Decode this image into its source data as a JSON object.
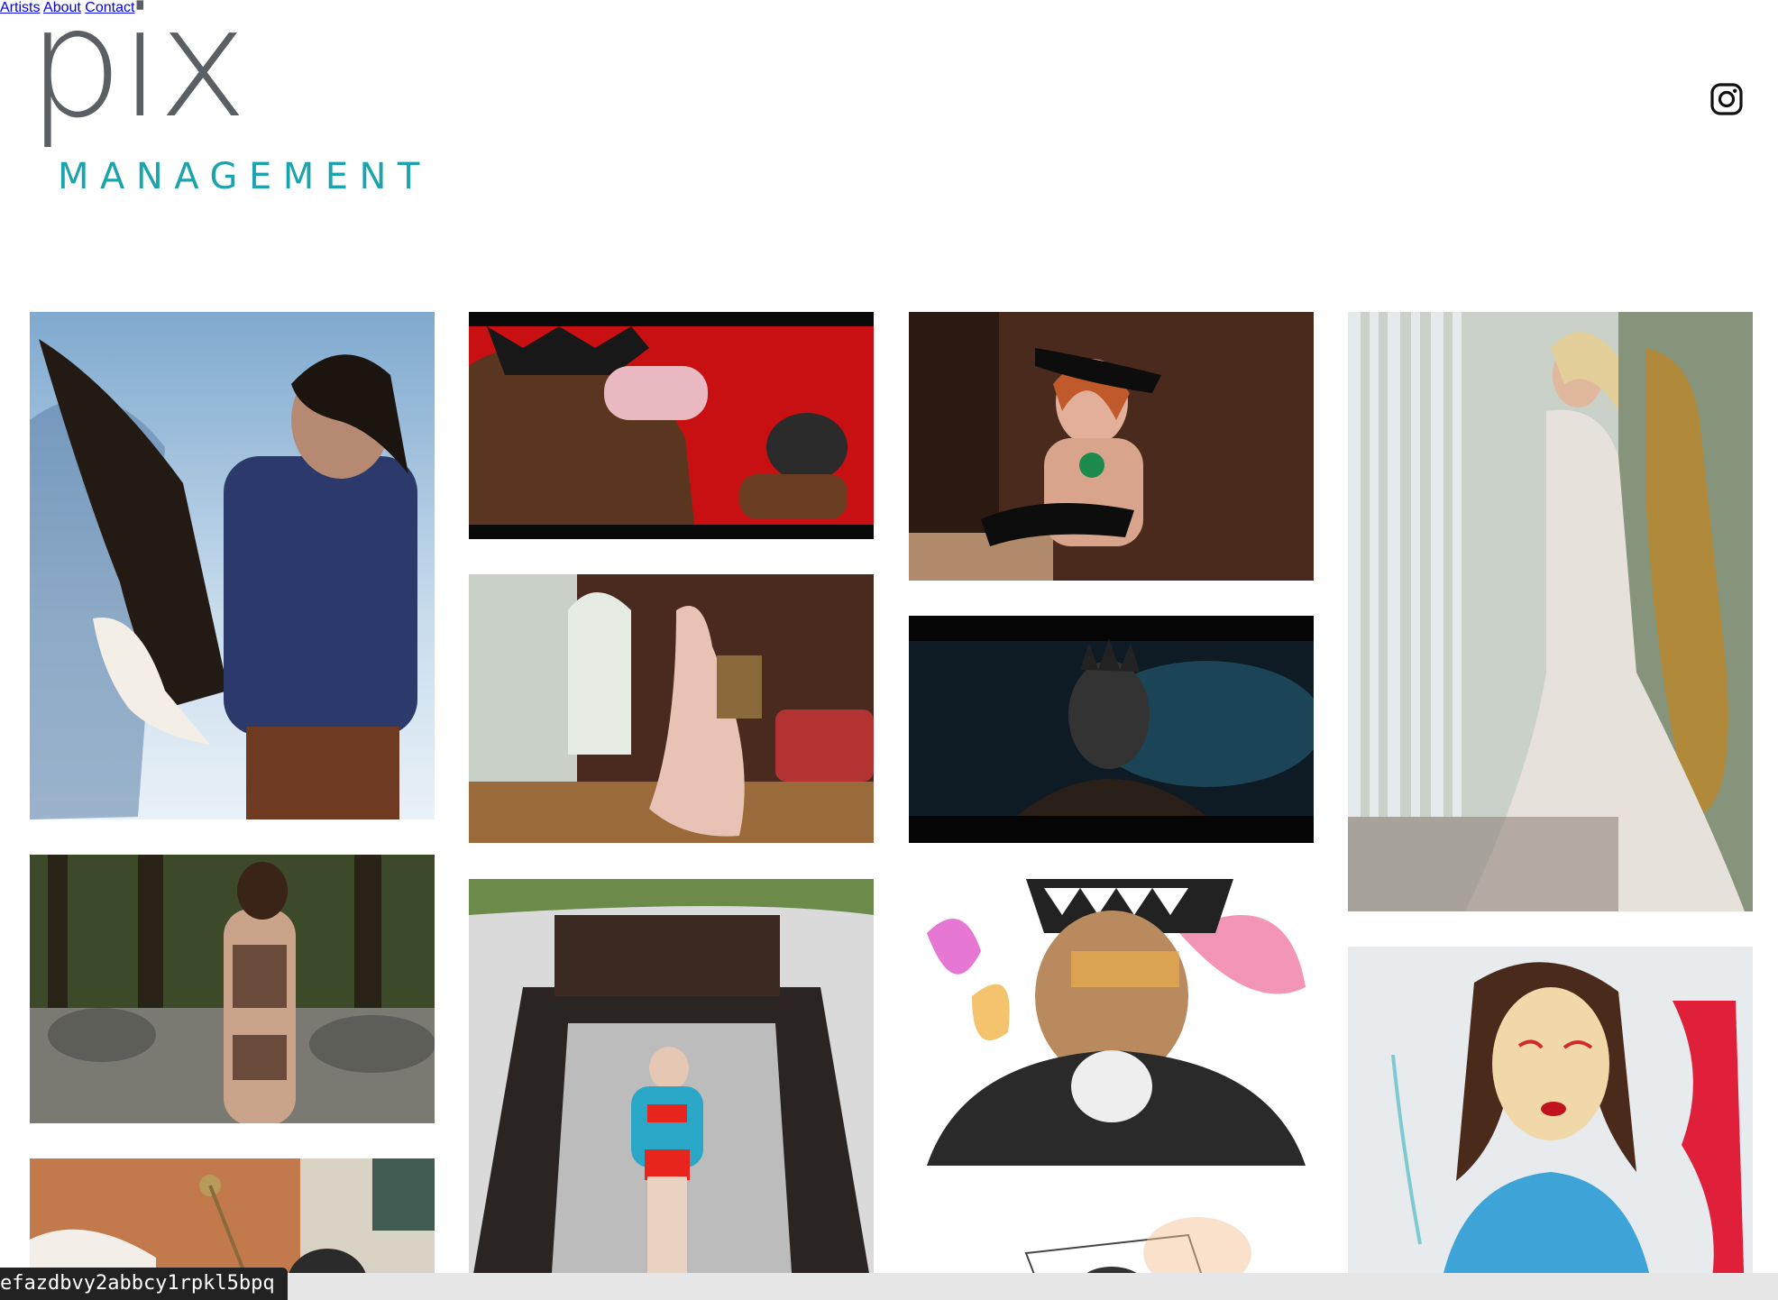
{
  "brand": {
    "word": "pix",
    "sub": "MANAGEMENT",
    "colors": {
      "pix": "#5b5f63",
      "sub": "#1ba3ae"
    }
  },
  "nav": {
    "items": [
      "Artists",
      "About",
      "Contact"
    ],
    "instagram_icon": "instagram-icon"
  },
  "gallery": {
    "tiles": [
      {
        "name": "gallery-image-eagle-portrait",
        "palette": [
          "#a9c8e0",
          "#2b3a6b",
          "#6e3a22"
        ]
      },
      {
        "name": "gallery-image-red-singer",
        "palette": [
          "#c81012",
          "#121212",
          "#5a3520"
        ]
      },
      {
        "name": "gallery-image-woman-black-gloves",
        "palette": [
          "#4a2a1c",
          "#d8a58c",
          "#1b8a4a"
        ]
      },
      {
        "name": "gallery-image-bridal-gown-window",
        "palette": [
          "#c9d1c9",
          "#e7e1dc",
          "#b08a3a"
        ]
      },
      {
        "name": "gallery-image-tulle-gown-room",
        "palette": [
          "#4a2a1f",
          "#e9c2b6",
          "#b33333"
        ]
      },
      {
        "name": "gallery-image-masked-figure",
        "palette": [
          "#0e1a24",
          "#1f4f63",
          "#222222"
        ]
      },
      {
        "name": "gallery-image-forest-rocks",
        "palette": [
          "#3d4a2a",
          "#6a4a3a",
          "#7a7a72"
        ]
      },
      {
        "name": "gallery-image-beach-boat",
        "palette": [
          "#dadada",
          "#2a2422",
          "#e8251d"
        ]
      },
      {
        "name": "gallery-image-illustration-portrait",
        "palette": [
          "#f07aa5",
          "#2a2a2a",
          "#f2b34a"
        ]
      },
      {
        "name": "gallery-image-painted-woman",
        "palette": [
          "#e7ebed",
          "#3ea3d6",
          "#e01f3a"
        ]
      },
      {
        "name": "gallery-image-interior-lamp",
        "palette": [
          "#c27a4c",
          "#f3efe8",
          "#2b2b2b"
        ]
      },
      {
        "name": "gallery-image-sketch-portrait",
        "palette": [
          "#ffffff",
          "#f5a55c",
          "#444444"
        ]
      }
    ]
  },
  "status_tooltip": "efazdbvy2abbcy1rpkl5bpq"
}
